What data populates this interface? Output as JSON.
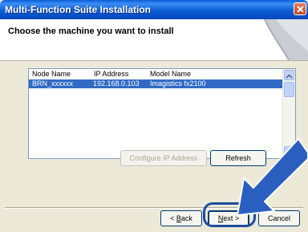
{
  "window": {
    "title": "Multi-Function Suite Installation"
  },
  "header": {
    "heading": "Choose the machine you want to install"
  },
  "list": {
    "columns": [
      "Node Name",
      "IP Address",
      "Model Name"
    ],
    "rows": [
      {
        "node_name": "BRN_xxxxxx",
        "ip_address": "192.168.0.103",
        "model_name": "Imagistics fx2100",
        "selected": true
      }
    ]
  },
  "buttons": {
    "configure_ip": "Configure IP Address",
    "refresh": "Refresh",
    "back_prefix": "< ",
    "back_accel": "B",
    "back_rest": "ack",
    "next_accel": "N",
    "next_rest": "ext >",
    "cancel": "Cancel"
  },
  "colors": {
    "titlebar": "#0b5ed7",
    "selection": "#316ac5",
    "callout_arrow": "#2a5fc0"
  },
  "icons": {
    "close": "close-icon",
    "pointer": "pointer-arrow-icon"
  }
}
